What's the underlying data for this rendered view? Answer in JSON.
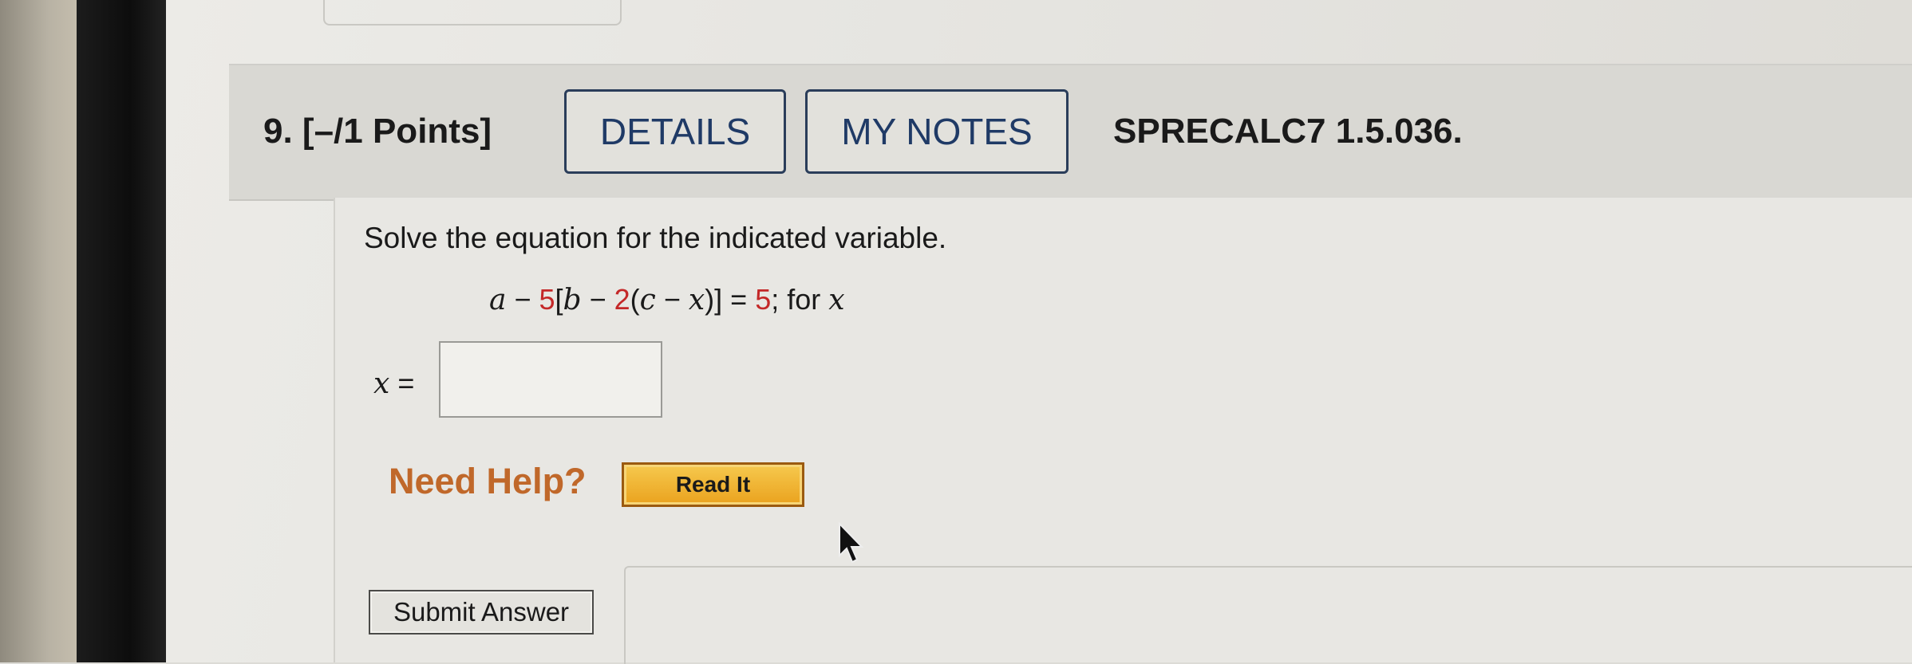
{
  "question": {
    "number_and_points": "9.  [–/1 Points]",
    "details_label": "DETAILS",
    "my_notes_label": "MY NOTES",
    "code": "SPRECALC7 1.5.036."
  },
  "problem": {
    "instruction": "Solve the equation for the indicated variable.",
    "equation": {
      "a": "a",
      "minus1": " − ",
      "five": "5",
      "bracket_open": "[",
      "b": "b",
      "minus2": " − ",
      "two": "2",
      "paren_open": "(",
      "c": "c",
      "minus3": " − ",
      "x": "x",
      "close": ")]",
      "equals": " = ",
      "rhs": "5",
      "suffix": ";  for ",
      "var": "x"
    },
    "answer_label_var": "x",
    "answer_label_eq": " =",
    "answer_value": ""
  },
  "help": {
    "need_help": "Need Help?",
    "read_it": "Read It"
  },
  "submit": {
    "label": "Submit Answer"
  },
  "icons": {
    "cursor": "mouse-pointer-icon"
  }
}
